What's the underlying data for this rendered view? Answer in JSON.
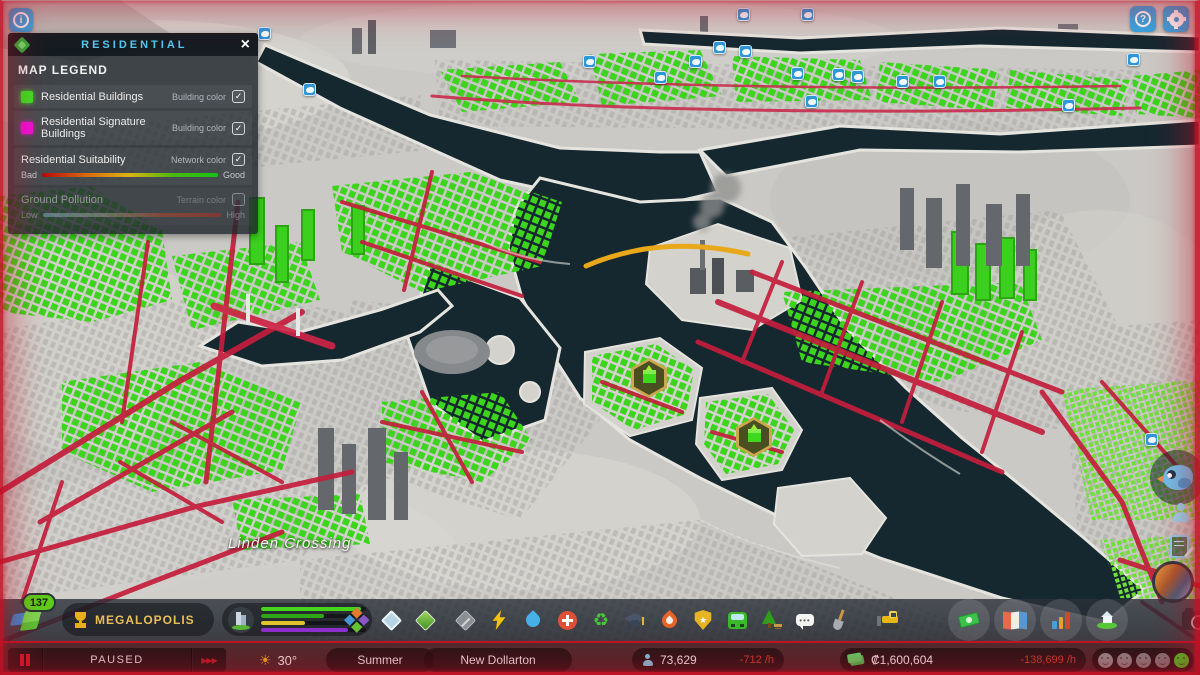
{
  "top_bar": {
    "info_glyph": "i",
    "help_glyph": "?"
  },
  "legend": {
    "title": "RESIDENTIAL",
    "section": "MAP LEGEND",
    "close_glyph": "×",
    "rows": [
      {
        "label": "Residential Buildings",
        "mode": "Building color",
        "check": "✓",
        "swatch": "#3ce026"
      },
      {
        "label": "Residential Signature Buildings",
        "mode": "Building color",
        "check": "✓",
        "swatch": "#ee12d6"
      },
      {
        "label": "Residential Suitability",
        "mode": "Network color",
        "check": "✓",
        "scale_left": "Bad",
        "scale_right": "Good"
      },
      {
        "label": "Ground Pollution",
        "mode": "Terrain color",
        "check": "",
        "scale_left": "Low",
        "scale_right": "High"
      }
    ]
  },
  "map": {
    "district_label": "Linden Crossing"
  },
  "progression": {
    "level": "137",
    "milestone": "MEGALOPOLIS"
  },
  "demand": {
    "bars": [
      {
        "color": "#46d41e",
        "pct": 95
      },
      {
        "color": "#2fa616",
        "pct": 60
      },
      {
        "color": "#e2c42e",
        "pct": 42
      },
      {
        "color": "#8c30ce",
        "pct": 83
      }
    ]
  },
  "toolbar": {
    "icons": [
      "zones",
      "areas",
      "terrain",
      "roads",
      "electricity",
      "water-sewage",
      "healthcare",
      "garbage",
      "education",
      "fire-rescue",
      "police",
      "transportation",
      "parks-recreation",
      "communications",
      "landscaping",
      "bulldozer",
      "economy",
      "map-tiles",
      "statistics",
      "progression",
      "photo-mode"
    ]
  },
  "glyphs": {
    "sun": "☀",
    "fast_forward": "▶▶▶",
    "recycle": "♻",
    "star": "★",
    "dots": "•••"
  },
  "status": {
    "speed_state": "PAUSED",
    "temperature": "30°",
    "season": "Summer",
    "city_name": "New Dollarton",
    "population": "73,629",
    "population_rate": "-712 /h",
    "money": "₡1,600,604",
    "money_rate": "-138,699 /h",
    "happiness_faces": [
      "#8e8e8e",
      "#888888",
      "#828282",
      "#7c7c7c",
      "#3ed428"
    ]
  }
}
